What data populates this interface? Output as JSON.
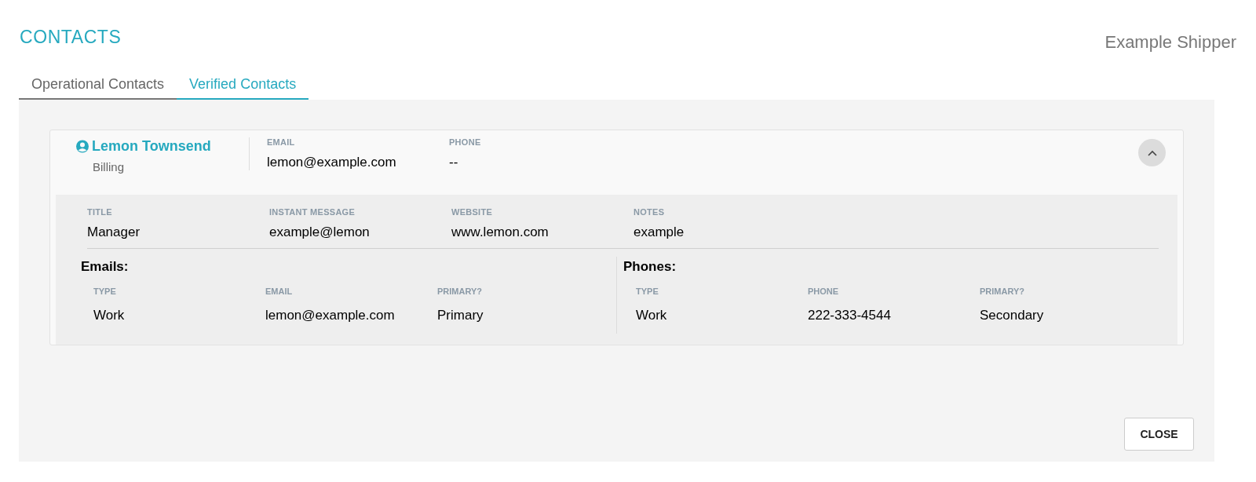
{
  "header": {
    "title": "CONTACTS",
    "company": "Example Shipper"
  },
  "tabs": [
    {
      "label": "Operational Contacts",
      "selected": false
    },
    {
      "label": "Verified Contacts",
      "selected": true
    }
  ],
  "contacts": [
    {
      "name": "Lemon Townsend",
      "role": "Billing",
      "expanded": true,
      "summary": [
        {
          "label": "EMAIL",
          "value": "lemon@example.com"
        },
        {
          "label": "PHONE",
          "value": "--"
        }
      ],
      "details": [
        {
          "label": "TITLE",
          "value": "Manager"
        },
        {
          "label": "INSTANT MESSAGE",
          "value": "example@lemon"
        },
        {
          "label": "WEBSITE",
          "value": "www.lemon.com"
        },
        {
          "label": "NOTES",
          "value": "example"
        }
      ],
      "sections": [
        {
          "title": "Emails:",
          "columns": [
            "TYPE",
            "EMAIL",
            "PRIMARY?"
          ],
          "rows": [
            [
              "Work",
              "lemon@example.com",
              "Primary"
            ]
          ]
        },
        {
          "title": "Phones:",
          "columns": [
            "TYPE",
            "PHONE",
            "PRIMARY?"
          ],
          "rows": [
            [
              "Work",
              "222-333-4544",
              "Secondary"
            ]
          ]
        }
      ]
    }
  ],
  "close_button": "CLOSE"
}
